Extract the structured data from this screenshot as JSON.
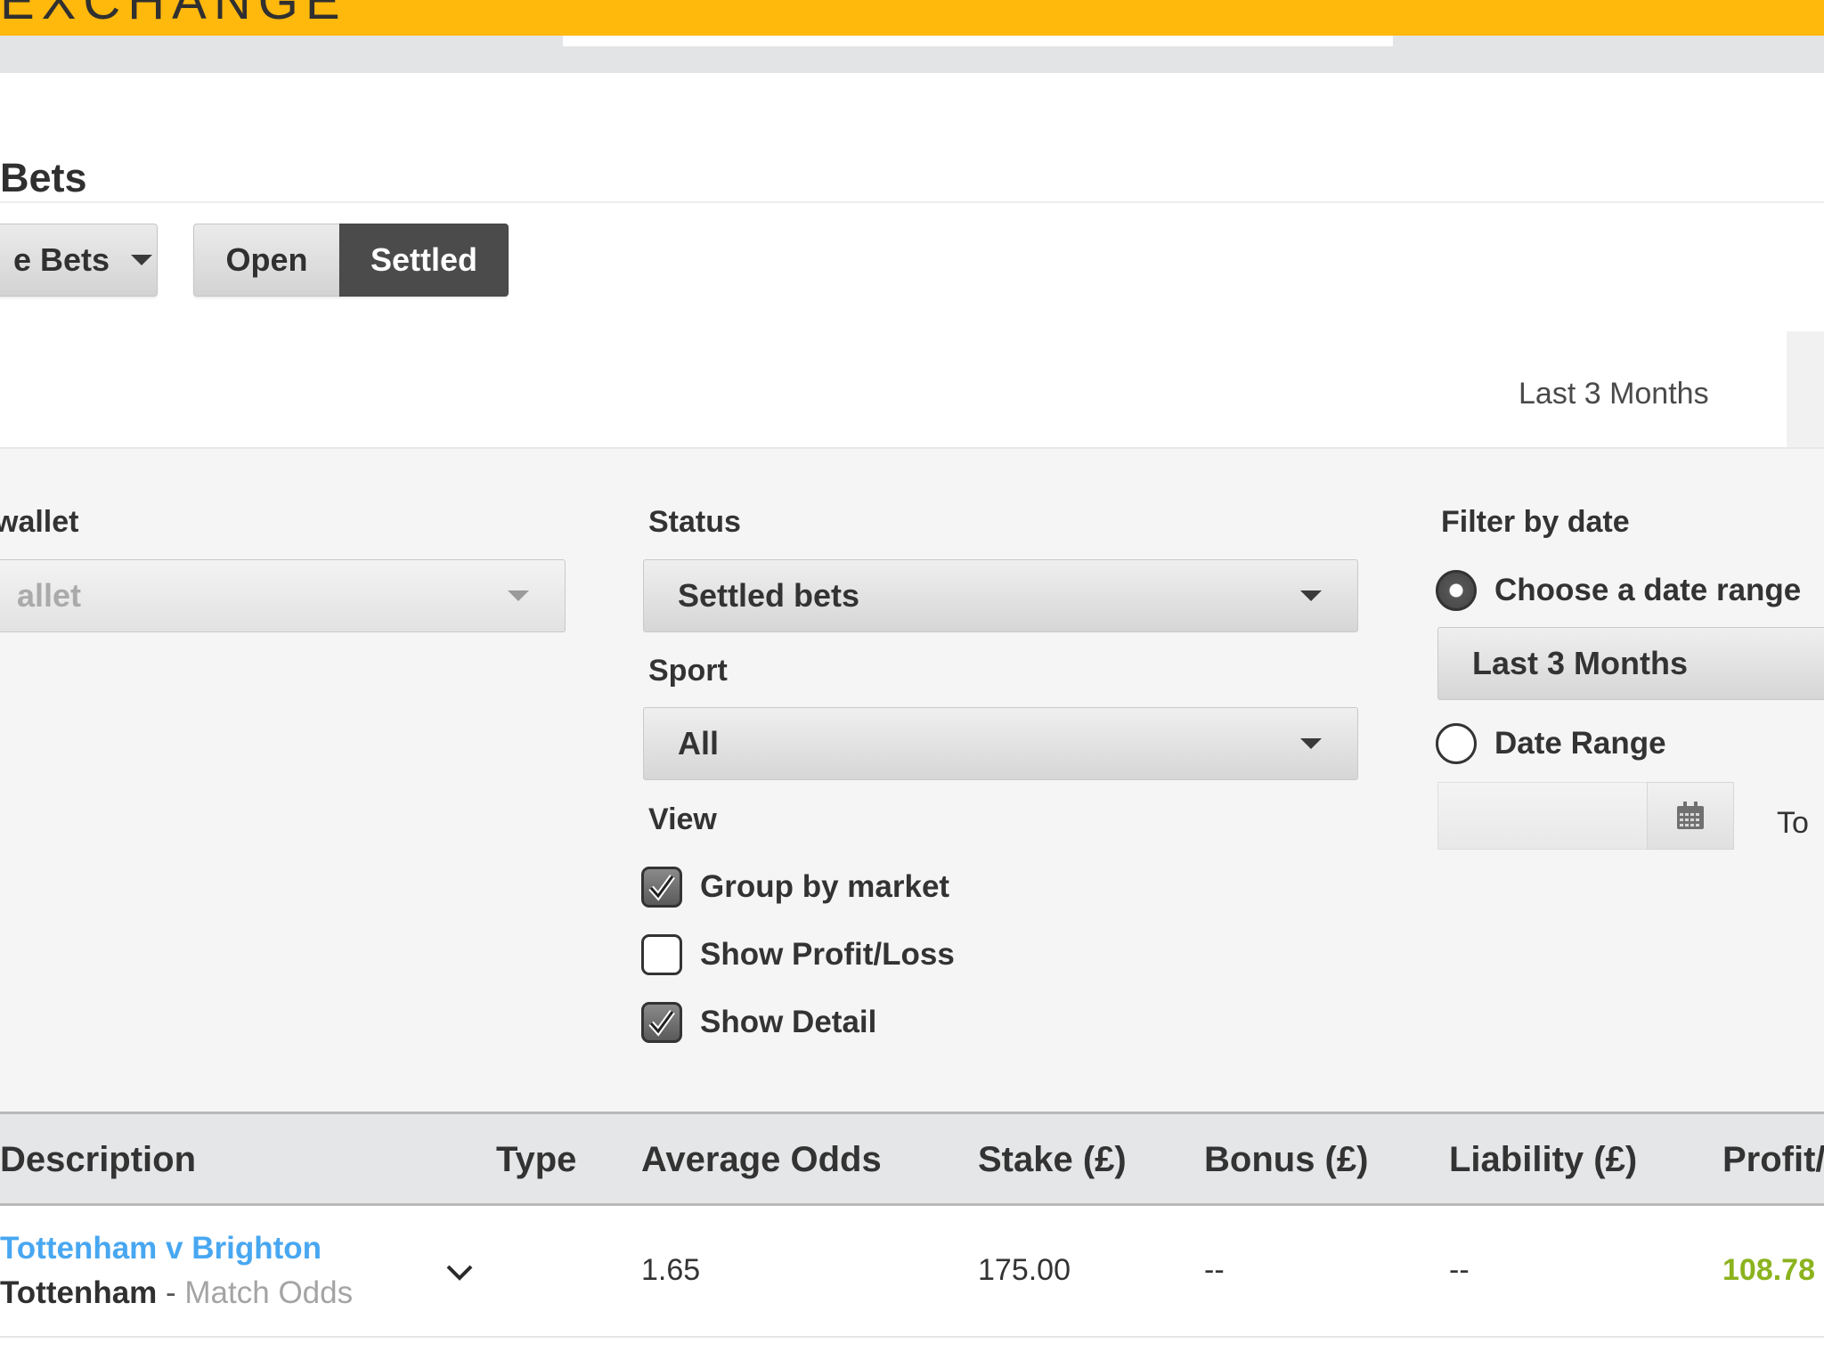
{
  "header": {
    "brand": "EXCHANGE",
    "brand_color": "#ffb80c"
  },
  "page": {
    "title": "Bets"
  },
  "bet_controls": {
    "bet_type_label": "e Bets",
    "open_label": "Open",
    "settled_label": "Settled",
    "active": "Settled"
  },
  "range_tab": {
    "label": "Last 3 Months"
  },
  "filters": {
    "wallet": {
      "label": "wallet",
      "value": "allet"
    },
    "status": {
      "label": "Status",
      "value": "Settled bets"
    },
    "sport": {
      "label": "Sport",
      "value": "All"
    },
    "view": {
      "label": "View",
      "options": [
        {
          "label": "Group by market",
          "checked": true
        },
        {
          "label": "Show Profit/Loss",
          "checked": false
        },
        {
          "label": "Show Detail",
          "checked": true
        }
      ]
    },
    "date": {
      "label": "Filter by date",
      "choose_range_label": "Choose a date range",
      "range_value": "Last 3 Months",
      "date_range_label": "Date Range",
      "to_label": "To",
      "selected": "Choose a date range"
    }
  },
  "table": {
    "columns": [
      "Description",
      "Type",
      "Average Odds",
      "Stake (£)",
      "Bonus (£)",
      "Liability (£)",
      "Profit/"
    ],
    "rows": [
      {
        "event": "Tottenham v Brighton",
        "selection": "Tottenham",
        "separator": " - ",
        "market": "Match Odds",
        "avg_odds": "1.65",
        "stake": "175.00",
        "bonus": "--",
        "liability": "--",
        "profit": "108.78"
      }
    ]
  },
  "colors": {
    "link": "#48a7f1",
    "profit_positive": "#8bb31e",
    "active_button": "#4b4b4b"
  },
  "icons": [
    "chevron-down-icon",
    "calendar-icon",
    "checkmark-icon",
    "caret-down-icon"
  ]
}
